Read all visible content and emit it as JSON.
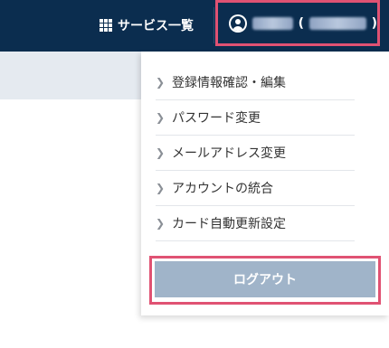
{
  "header": {
    "services_label": "サービス一覧",
    "services_icon": "grid-icon",
    "user_icon": "user-circle-icon",
    "user_paren_open": "(",
    "user_paren_close": ")"
  },
  "dropdown": {
    "items": [
      {
        "label": "登録情報確認・編集"
      },
      {
        "label": "パスワード変更"
      },
      {
        "label": "メールアドレス変更"
      },
      {
        "label": "アカウントの統合"
      },
      {
        "label": "カード自動更新設定"
      }
    ],
    "logout_label": "ログアウト"
  },
  "colors": {
    "header_bg": "#0b2d4f",
    "highlight": "#e05273",
    "logout_bg": "#a0b4c9",
    "subbar_bg": "#e5eaf0"
  }
}
